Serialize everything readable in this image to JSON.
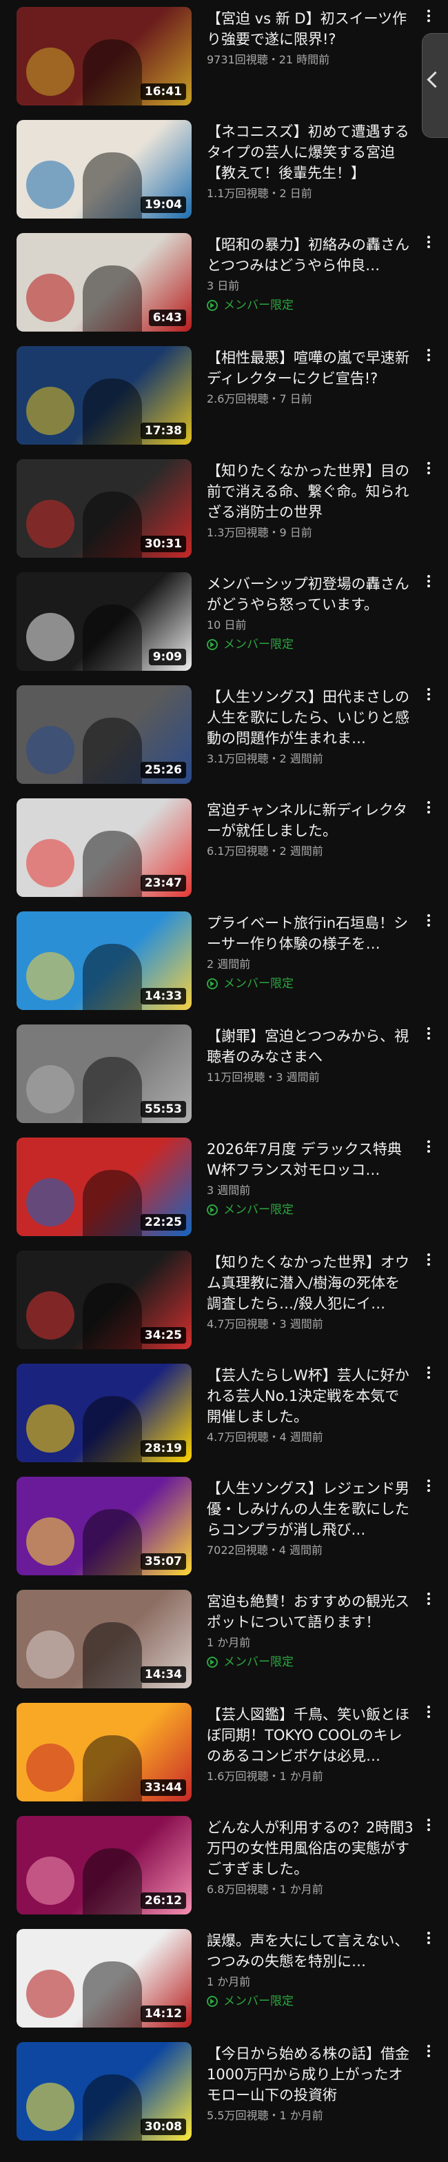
{
  "member_label": "メンバー限定",
  "videos": [
    {
      "title": "【宮迫 vs 新 D】初スイーツ作り強要で遂に限界!?",
      "meta": "9731回視聴・21 時間前",
      "duration": "16:41",
      "member_only": false,
      "progress": 0.0,
      "thumb_colors": [
        "#6b1d1d",
        "#c9a227"
      ]
    },
    {
      "title": "【ネコニスズ】初めて遭遇するタイプの芸人に爆笑する宮迫【教えて！後輩先生！】",
      "meta": "1.1万回視聴・2 日前",
      "duration": "19:04",
      "member_only": false,
      "progress": 0.0,
      "thumb_colors": [
        "#e8e2d8",
        "#1f6fb0"
      ]
    },
    {
      "title": "【昭和の暴力】初絡みの轟さんとつつみはどうやら仲良…",
      "meta": "3 日前",
      "duration": "6:43",
      "member_only": true,
      "progress": 0.0,
      "thumb_colors": [
        "#d9d4cc",
        "#b71c1c"
      ]
    },
    {
      "title": "【相性最悪】喧嘩の嵐で早速新ディレクターにクビ宣告!?",
      "meta": "2.6万回視聴・7 日前",
      "duration": "17:38",
      "member_only": false,
      "progress": 0.0,
      "thumb_colors": [
        "#1a3a6b",
        "#e0c020"
      ]
    },
    {
      "title": "【知りたくなかった世界】目の前で消える命、繋ぐ命。知られざる消防士の世界",
      "meta": "1.3万回視聴・9 日前",
      "duration": "30:31",
      "member_only": false,
      "progress": 0.0,
      "thumb_colors": [
        "#2a2a2a",
        "#c62828"
      ]
    },
    {
      "title": "メンバーシップ初登場の轟さんがどうやら怒っています。",
      "meta": "10 日前",
      "duration": "9:09",
      "member_only": true,
      "progress": 0.0,
      "thumb_colors": [
        "#1a1a1a",
        "#eeeeee"
      ]
    },
    {
      "title": "【人生ソングス】田代まさしの人生を歌にしたら、いじりと感動の問題作が生まれま…",
      "meta": "3.1万回視聴・2 週間前",
      "duration": "25:26",
      "member_only": false,
      "progress": 0.0,
      "thumb_colors": [
        "#5a5a5a",
        "#2a4a8a"
      ]
    },
    {
      "title": "宮迫チャンネルに新ディレクターが就任しました。",
      "meta": "6.1万回視聴・2 週間前",
      "duration": "23:47",
      "member_only": false,
      "progress": 0.0,
      "thumb_colors": [
        "#d8d8d8",
        "#e53935"
      ]
    },
    {
      "title": "プライベート旅行in石垣島！シーサー作り体験の様子を…",
      "meta": "2 週間前",
      "duration": "14:33",
      "member_only": true,
      "progress": 0.0,
      "thumb_colors": [
        "#2b8fd6",
        "#f5d142"
      ]
    },
    {
      "title": "【謝罪】宮迫とつつみから、視聴者のみなさまへ",
      "meta": "11万回視聴・3 週間前",
      "duration": "55:53",
      "member_only": false,
      "progress": 0.0,
      "thumb_colors": [
        "#7a7a7a",
        "#b0b0b0"
      ]
    },
    {
      "title": "2026年7月度 デラックス特典 W杯フランス対モロッコ…",
      "meta": "3 週間前",
      "duration": "22:25",
      "member_only": true,
      "progress": 0.0,
      "thumb_colors": [
        "#c62828",
        "#1565c0"
      ]
    },
    {
      "title": "【知りたくなかった世界】オウム真理教に潜入/樹海の死体を調査したら…/殺人犯にイ…",
      "meta": "4.7万回視聴・3 週間前",
      "duration": "34:25",
      "member_only": false,
      "progress": 0.0,
      "thumb_colors": [
        "#1b1b1b",
        "#d32f2f"
      ]
    },
    {
      "title": "【芸人たらしW杯】芸人に好かれる芸人No.1決定戦を本気で開催しました。",
      "meta": "4.7万回視聴・4 週間前",
      "duration": "28:19",
      "member_only": false,
      "progress": 0.0,
      "thumb_colors": [
        "#1a237e",
        "#ffd600"
      ]
    },
    {
      "title": "【人生ソングス】レジェンド男優・しみけんの人生を歌にしたらコンプラが消し飛び…",
      "meta": "7022回視聴・4 週間前",
      "duration": "35:07",
      "member_only": false,
      "progress": 0.0,
      "thumb_colors": [
        "#6a1b9a",
        "#fdd835"
      ]
    },
    {
      "title": "宮迫も絶賛！おすすめの観光スポットについて語ります！",
      "meta": "1 か月前",
      "duration": "14:34",
      "member_only": true,
      "progress": 0.0,
      "thumb_colors": [
        "#8d6e63",
        "#d7ccc8"
      ]
    },
    {
      "title": "【芸人図鑑】千鳥、笑い飯とほぼ同期！TOKYO COOLのキレのあるコンビボケは必見…",
      "meta": "1.6万回視聴・1 か月前",
      "duration": "33:44",
      "member_only": false,
      "progress": 0.0,
      "thumb_colors": [
        "#f9a825",
        "#c62828"
      ]
    },
    {
      "title": "どんな人が利用するの？2時間3万円の女性用風俗店の実態がすごすぎました。",
      "meta": "6.8万回視聴・1 か月前",
      "duration": "26:12",
      "member_only": false,
      "progress": 0.0,
      "thumb_colors": [
        "#880e4f",
        "#f48fb1"
      ]
    },
    {
      "title": "誤爆。声を大にして言えない、つつみの失態を特別に…",
      "meta": "1 か月前",
      "duration": "14:12",
      "member_only": true,
      "progress": 0.0,
      "thumb_colors": [
        "#eeeeee",
        "#b71c1c"
      ]
    },
    {
      "title": "【今日から始める株の話】借金1000万円から成り上がったオモロー山下の投資術",
      "meta": "5.5万回視聴・1 か月前",
      "duration": "30:08",
      "member_only": false,
      "progress": 0.0,
      "thumb_colors": [
        "#0d47a1",
        "#ffeb3b"
      ]
    }
  ]
}
